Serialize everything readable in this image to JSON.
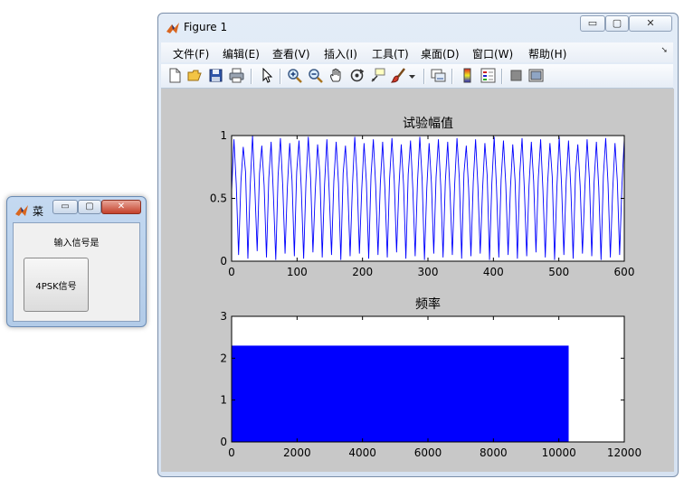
{
  "small_window": {
    "title": "菜",
    "label": "输入信号是",
    "button_label": "4PSK信号",
    "minimize_glyph": "▭",
    "maximize_glyph": "▢",
    "close_glyph": "✕"
  },
  "figure_window": {
    "title": "Figure 1",
    "minimize_glyph": "▭",
    "maximize_glyph": "▢",
    "close_glyph": "✕",
    "menu": [
      "文件(F)",
      "编辑(E)",
      "查看(V)",
      "插入(I)",
      "工具(T)",
      "桌面(D)",
      "窗口(W)",
      "帮助(H)"
    ],
    "menu_more_glyph": "➘",
    "toolbar_icons": [
      "new-figure-icon",
      "open-file-icon",
      "save-icon",
      "print-icon",
      "pointer-icon",
      "zoom-in-icon",
      "zoom-out-icon",
      "pan-hand-icon",
      "rotate-3d-icon",
      "data-cursor-icon",
      "brush-icon",
      "brush-dropdown-icon",
      "link-plot-icon",
      "colorbar-icon",
      "legend-icon",
      "hide-plot-tools-icon",
      "show-plot-tools-icon"
    ]
  },
  "colors": {
    "plot_line": "#0000ff",
    "bar_fill": "#0000ff",
    "figure_background": "#c8c8c8",
    "axes_background": "#ffffff"
  },
  "chart_data": [
    {
      "type": "line",
      "title": "试验幅值",
      "xlim": [
        0,
        600
      ],
      "ylim": [
        0,
        1
      ],
      "xticks": [
        0,
        100,
        200,
        300,
        400,
        500,
        600
      ],
      "yticks": [
        0,
        0.5,
        1
      ],
      "yticklabels": [
        "0",
        "0.5",
        "1"
      ],
      "series": [
        {
          "x_range": [
            0,
            600
          ],
          "values": [
            0.56,
            0.97,
            0.61,
            0.05,
            0.63,
            0.91,
            0.71,
            0.02,
            0.6,
            1.0,
            0.58,
            0.08,
            0.7,
            0.92,
            0.6,
            0.03,
            0.66,
            0.95,
            0.52,
            0.01,
            0.68,
            0.98,
            0.6,
            0.06,
            0.59,
            0.94,
            0.64,
            0.04,
            0.71,
            0.96,
            0.57,
            0.02,
            0.63,
            0.99,
            0.66,
            0.07,
            0.56,
            0.93,
            0.69,
            0.03,
            0.61,
            0.97,
            0.55,
            0.05,
            0.64,
            0.95,
            0.62,
            0.01,
            0.7,
            0.92,
            0.58,
            0.04,
            0.6,
            0.99,
            0.67,
            0.06,
            0.57,
            0.94,
            0.63,
            0.02,
            0.68,
            0.97,
            0.6,
            0.05,
            0.62,
            0.95,
            0.56,
            0.03,
            0.66,
            0.98,
            0.64,
            0.07,
            0.59,
            0.93,
            0.61,
            0.02,
            0.69,
            0.96,
            0.57,
            0.04,
            0.63,
            0.99,
            0.65,
            0.01,
            0.58,
            0.94,
            0.62,
            0.06,
            0.67,
            0.97,
            0.6,
            0.03,
            0.64,
            0.95,
            0.55,
            0.05,
            0.61,
            0.98,
            0.66,
            0.02,
            0.7,
            0.92,
            0.58,
            0.04,
            0.63,
            0.97,
            0.6,
            0.06,
            0.57,
            0.94,
            0.68,
            0.01,
            0.62,
            0.99,
            0.59,
            0.03,
            0.65,
            0.96,
            0.61,
            0.05,
            0.58,
            0.93,
            0.64,
            0.02,
            0.69,
            0.98,
            0.57,
            0.04,
            0.6,
            0.95,
            0.63,
            0.07,
            0.66,
            0.97,
            0.56,
            0.03,
            0.62,
            0.94,
            0.67,
            0.01,
            0.59,
            0.99,
            0.61,
            0.05,
            0.64,
            0.96,
            0.58,
            0.02,
            0.7,
            0.93,
            0.6,
            0.06,
            0.57,
            0.97,
            0.65,
            0.04,
            0.63,
            0.95,
            0.59,
            0.01,
            0.68,
            0.98,
            0.62,
            0.03,
            0.56,
            0.94,
            0.64,
            0.05,
            0.61,
            0.97
          ]
        }
      ]
    },
    {
      "type": "bar",
      "title": "频率",
      "xlim": [
        0,
        12000
      ],
      "ylim": [
        0,
        3
      ],
      "xticks": [
        0,
        2000,
        4000,
        6000,
        8000,
        10000,
        12000
      ],
      "xticklabels": [
        "0",
        "2000",
        "4000",
        "6000",
        "8000",
        "10000",
        "12000"
      ],
      "yticks": [
        0,
        1,
        2,
        3
      ],
      "bars": [
        {
          "x_start": 0,
          "x_end": 10300,
          "value": 2.3
        }
      ]
    }
  ]
}
